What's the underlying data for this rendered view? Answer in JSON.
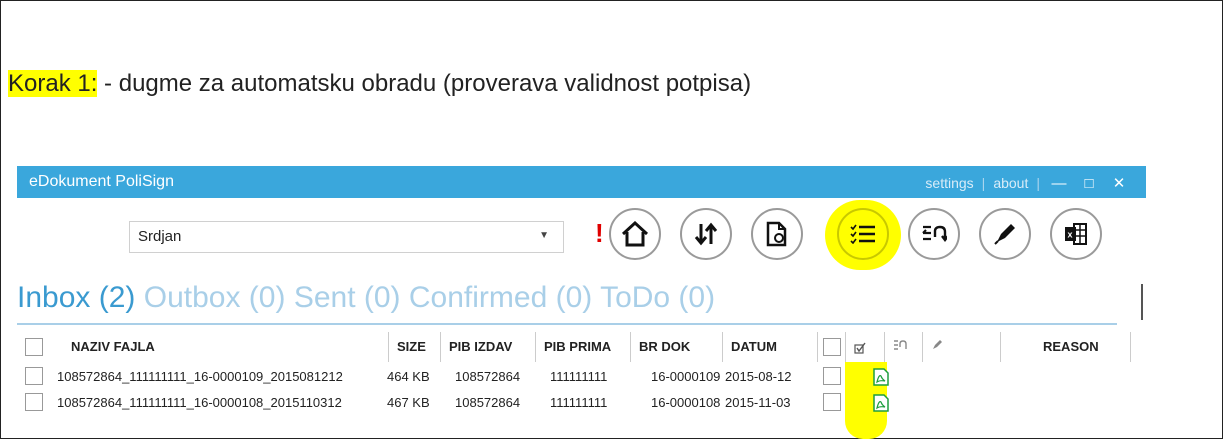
{
  "heading": {
    "prefix": "Korak 1:",
    "text": " - dugme za automatsku obradu (proverava validnost potpisa)"
  },
  "window": {
    "title": "eDokument PoliSign",
    "settings": "settings",
    "about": "about",
    "separator": "|",
    "minimize": "—",
    "maximize": "□",
    "close": "✕"
  },
  "toolbar": {
    "user_select": "Srdjan",
    "warning": "!",
    "buttons": [
      "home-icon",
      "sort-icon",
      "document-icon",
      "checklist-icon",
      "return-icon",
      "pen-icon",
      "excel-icon"
    ]
  },
  "tabs": [
    {
      "label": "Inbox (2)",
      "active": true
    },
    {
      "label": "Outbox (0)",
      "active": false
    },
    {
      "label": "Sent (0)",
      "active": false
    },
    {
      "label": "Confirmed (0)",
      "active": false
    },
    {
      "label": "ToDo (0)",
      "active": false
    }
  ],
  "columns": [
    "NAZIV FAJLA",
    "SIZE",
    "PIB IZDAV",
    "PIB PRIMA",
    "BR DOK",
    "DATUM",
    "REASON"
  ],
  "rows": [
    {
      "name": "108572864_111111111_16-0000109_2015081212",
      "size": "464 KB",
      "pib_izdav": "108572864",
      "pib_prima": "111111111",
      "br_dok": "16-0000109",
      "datum": "2015-08-12"
    },
    {
      "name": "108572864_111111111_16-0000108_2015110312",
      "size": "467 KB",
      "pib_izdav": "108572864",
      "pib_prima": "111111111",
      "br_dok": "16-0000108",
      "datum": "2015-11-03"
    }
  ],
  "colors": {
    "titlebar": "#3aa7dc",
    "highlight": "#ffff00",
    "tab_active": "#3a9ad0",
    "tab_inactive": "#a9cfe8"
  }
}
